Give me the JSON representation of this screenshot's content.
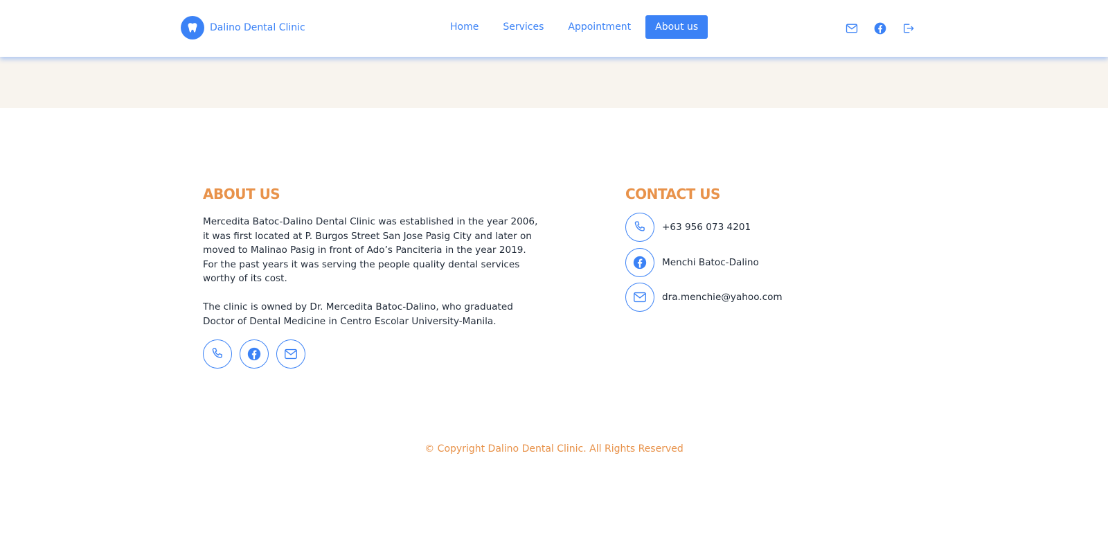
{
  "brand": {
    "name": "Dalino Dental Clinic",
    "icon": "tooth-icon"
  },
  "nav": {
    "links": [
      {
        "label": "Home",
        "active": false
      },
      {
        "label": "Services",
        "active": false
      },
      {
        "label": "Appointment",
        "active": false
      },
      {
        "label": "About us",
        "active": true
      }
    ],
    "icons": [
      "mail-icon",
      "facebook-icon",
      "logout-icon"
    ]
  },
  "about": {
    "title": "ABOUT US",
    "paragraph1": "Mercedita Batoc-Dalino Dental Clinic was established in the year 2006,\nit was first located at P. Burgos Street San Jose Pasig City and later on\nmoved to Malinao Pasig in front of Ado’s Panciteria in the year 2019.\nFor the past years it was serving the people quality dental services\nworthy of its cost.",
    "paragraph2": "The clinic is owned by Dr. Mercedita Batoc-Dalino, who graduated\nDoctor of Dental Medicine in Centro Escolar University-Manila.",
    "social_icons": [
      "phone-icon",
      "facebook-icon",
      "mail-icon"
    ]
  },
  "contact": {
    "title": "CONTACT US",
    "items": [
      {
        "icon": "phone-icon",
        "text": "+63 956 073 4201"
      },
      {
        "icon": "facebook-icon",
        "text": "Menchi Batoc-Dalino"
      },
      {
        "icon": "mail-icon",
        "text": "dra.menchie@yahoo.com"
      }
    ]
  },
  "footer": {
    "copyright": "© Copyright Dalino Dental Clinic. All Rights Reserved"
  },
  "colors": {
    "primary": "#3b82f6",
    "accent": "#e8924a",
    "banner": "#f8f4ee",
    "text": "#1f2937"
  }
}
